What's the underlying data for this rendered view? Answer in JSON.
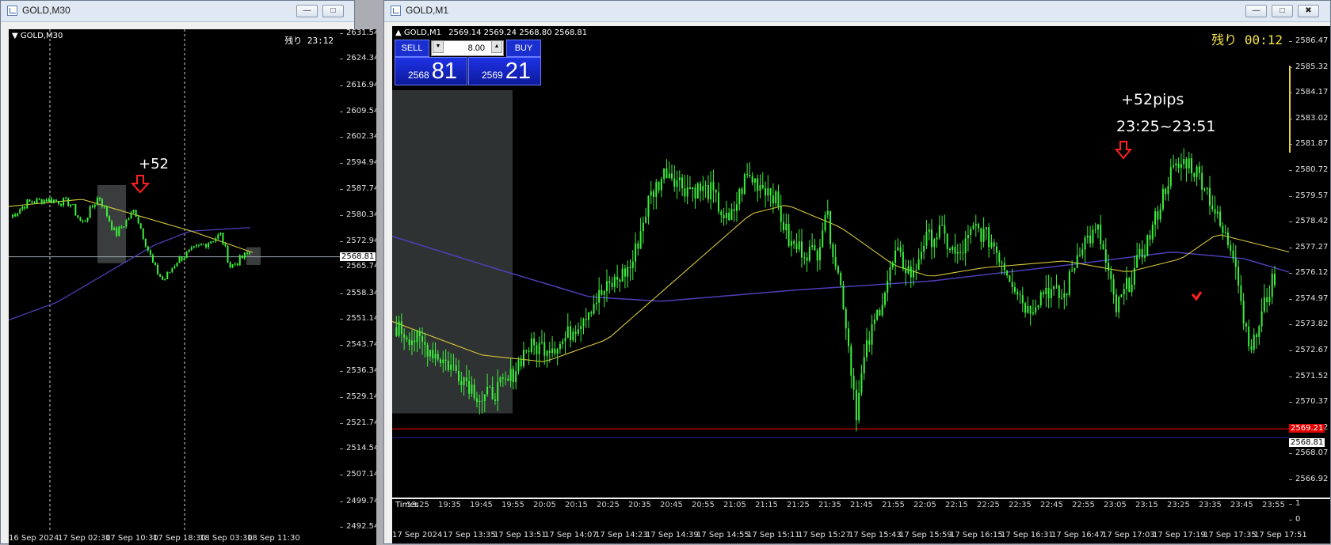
{
  "left_window": {
    "title": "GOLD,M30",
    "chart_symbol": "GOLD,M30",
    "timer_label": "残り",
    "timer_value": "23:12",
    "annotation": "+52",
    "price_label": "2568.81",
    "y_ticks": [
      "2631.54",
      "2624.34",
      "2616.94",
      "2609.54",
      "2602.34",
      "2594.94",
      "2587.74",
      "2580.34",
      "2572.94",
      "2565.74",
      "2558.34",
      "2551.14",
      "2543.74",
      "2536.34",
      "2529.14",
      "2521.74",
      "2514.54",
      "2507.14",
      "2499.74",
      "2492.54"
    ],
    "x_labels": [
      "16 Sep 2024",
      "17 Sep 02:30",
      "17 Sep 10:30",
      "17 Sep 18:30",
      "18 Sep 03:30",
      "18 Sep 11:30"
    ]
  },
  "right_window": {
    "title": "GOLD,M1",
    "chart_symbol": "GOLD,M1",
    "ohlc": "2569.14 2569.24 2568.80 2568.81",
    "timer_label": "残り",
    "timer_value": "00:12",
    "annotation_pips": "+52pips",
    "annotation_range": "23:25~23:51",
    "one_click": {
      "sell_label": "SELL",
      "buy_label": "BUY",
      "lot": "8.00",
      "sell_small": "2568",
      "sell_big": "81",
      "buy_small": "2569",
      "buy_big": "21"
    },
    "price_label_red": "2569.21",
    "price_label_white": "2568.81",
    "y_ticks": [
      "2586.47",
      "2585.32",
      "2584.17",
      "2583.02",
      "2581.87",
      "2580.72",
      "2579.57",
      "2578.42",
      "2577.27",
      "2576.12",
      "2574.97",
      "2573.82",
      "2572.67",
      "2571.52",
      "2570.37",
      "2569.22",
      "2568.07",
      "2566.92"
    ],
    "times_label": "Times",
    "times_axis": [
      "13:25",
      "19:35",
      "19:45",
      "19:55",
      "20:05",
      "20:15",
      "20:25",
      "20:35",
      "20:45",
      "20:55",
      "21:05",
      "21:15",
      "21:25",
      "21:35",
      "21:45",
      "21:55",
      "22:05",
      "22:15",
      "22:25",
      "22:35",
      "22:45",
      "22:55",
      "23:05",
      "23:15",
      "23:25",
      "23:35",
      "23:45",
      "23:55"
    ],
    "sub_scale": [
      "1",
      "0"
    ],
    "x_labels": [
      "17 Sep 2024",
      "17 Sep 13:35",
      "17 Sep 13:51",
      "17 Sep 14:07",
      "17 Sep 14:23",
      "17 Sep 14:39",
      "17 Sep 14:55",
      "17 Sep 15:11",
      "17 Sep 15:27",
      "17 Sep 15:43",
      "17 Sep 15:59",
      "17 Sep 16:15",
      "17 Sep 16:31",
      "17 Sep 16:47",
      "17 Sep 17:03",
      "17 Sep 17:19",
      "17 Sep 17:35",
      "17 Sep 17:51"
    ]
  },
  "colors": {
    "candles": "#3cf03c",
    "ma_fast": "#d8c83a",
    "ma_slow": "#4d3fb8",
    "arrow": "#ff2020",
    "bid_line": "#ff0000",
    "ask_line": "#1a2090"
  }
}
